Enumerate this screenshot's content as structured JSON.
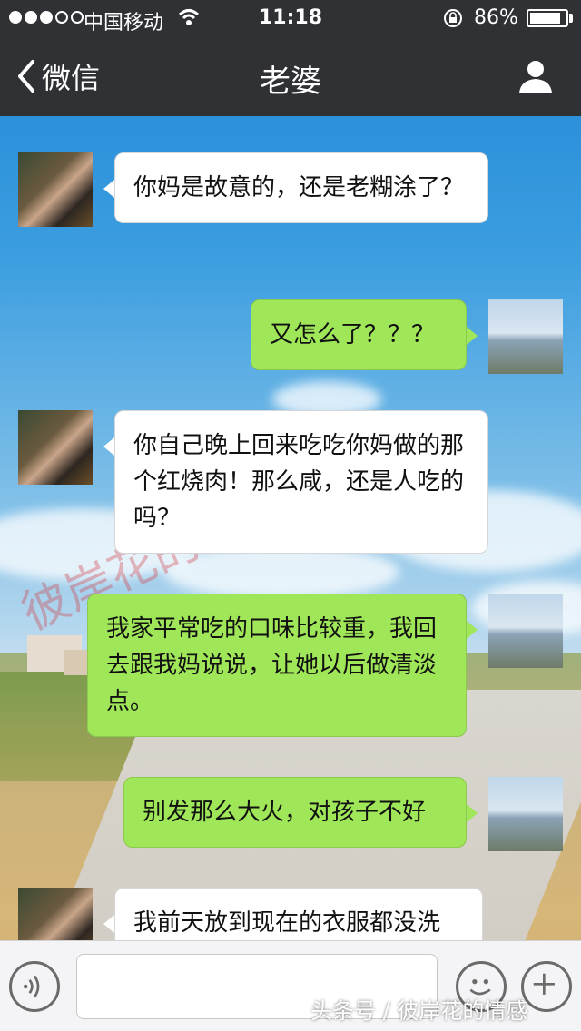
{
  "status_bar": {
    "carrier": "中国移动",
    "time": "11:18",
    "battery_percent": "86%",
    "battery_level": 0.86,
    "signal_strength": 3
  },
  "nav": {
    "back_label": "微信",
    "title": "老婆",
    "profile_icon": "person-icon"
  },
  "messages": [
    {
      "sender": "her",
      "text": "你妈是故意的，还是老糊涂了？"
    },
    {
      "sender": "me",
      "text": "又怎么了？？？"
    },
    {
      "sender": "her",
      "text": "你自己晚上回来吃吃你妈做的那个红烧肉！那么咸，还是人吃的吗？"
    },
    {
      "sender": "me",
      "text": "我家平常吃的口味比较重，我回去跟我妈说说，让她以后做清淡点。"
    },
    {
      "sender": "me",
      "text": "别发那么大火，对孩子不好"
    },
    {
      "sender": "her",
      "text": "我前天放到现在的衣服都没洗"
    }
  ],
  "watermark": "彼岸花的情感",
  "credit": "头条号 / 彼岸花的情感",
  "input": {
    "value": "",
    "placeholder": ""
  },
  "colors": {
    "bar_bg": "#2f3134",
    "bubble_mine": "#9fe658",
    "bubble_theirs": "#ffffff"
  }
}
